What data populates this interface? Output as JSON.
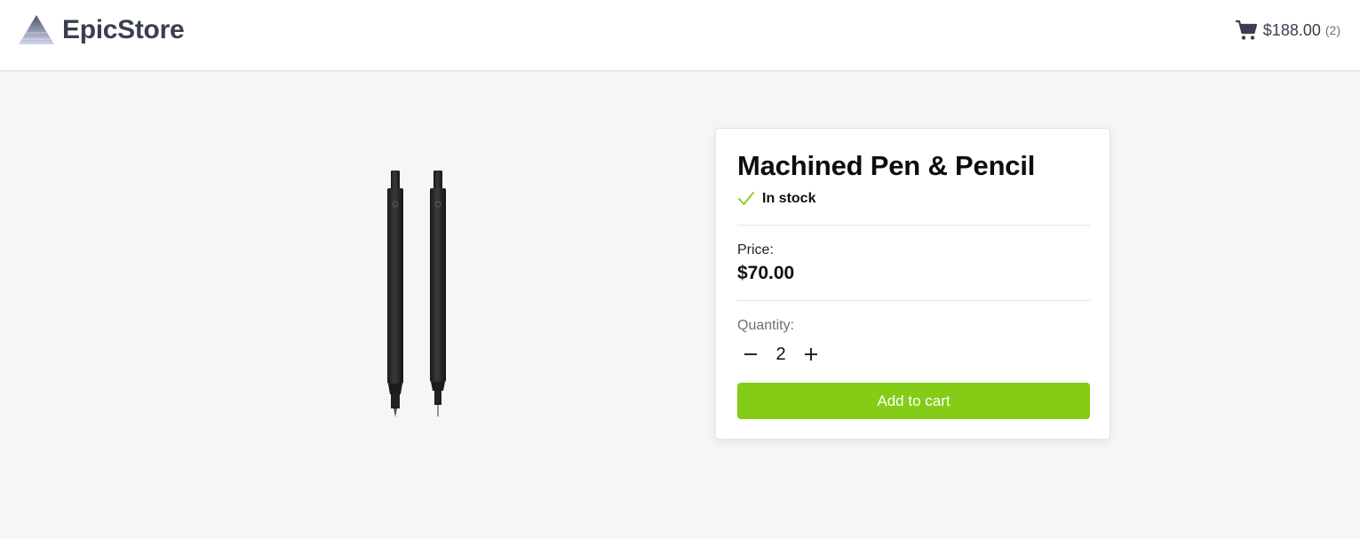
{
  "header": {
    "brand_name": "EpicStore",
    "logo_icon": "pyramid-logo-icon",
    "cart": {
      "icon": "shopping-cart-icon",
      "total": "$188.00",
      "count": "(2)"
    }
  },
  "product": {
    "title": "Machined Pen & Pencil",
    "stock_status": "In stock",
    "stock_icon": "checkmark-icon",
    "image_icon": "pen-and-pencil-image",
    "price_label": "Price:",
    "price": "$70.00",
    "quantity_label": "Quantity:",
    "quantity": "2",
    "add_to_cart_label": "Add to cart"
  },
  "colors": {
    "accent": "#84cc16",
    "brand_text": "#3a3f4e",
    "page_background": "#f6f6f6"
  }
}
